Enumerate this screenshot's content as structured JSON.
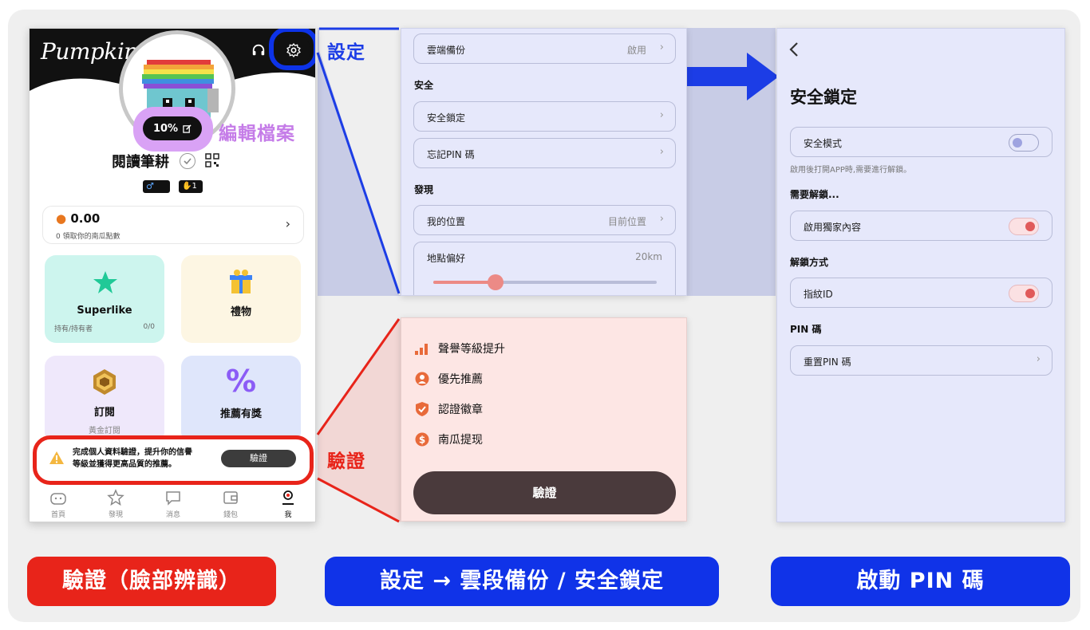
{
  "colors": {
    "blue_accent": "#1c3de6",
    "red_accent": "#e8241a",
    "purple_accent": "#c57ce8",
    "panel_lavender": "#e6e8fb",
    "panel_pink": "#fde6e4",
    "button_dark": "#4a3a3c"
  },
  "profile": {
    "app_logo": "Pumpkin",
    "completion_pct": "10%",
    "edit_annotation": "編輯檔案",
    "username": "閱讀筆耕",
    "gender_badge": "♂",
    "level_badge": "1",
    "points_value": "0.00",
    "points_sub": "0 領取你的南瓜點數",
    "tiles": {
      "superlike": {
        "title": "Superlike",
        "sub_left": "持有/持有者",
        "sub_right": "0/0"
      },
      "gift": {
        "title": "禮物"
      },
      "subscribe": {
        "title": "訂閱",
        "sub": "黃金訂閱"
      },
      "referral": {
        "title": "推薦有獎"
      }
    },
    "verify_banner": {
      "line1": "完成個人資料驗證，提升你的信譽",
      "line2": "等級並獲得更高品質的推薦。",
      "button": "驗證"
    },
    "tabs": [
      {
        "label": "首頁",
        "icon": "home-icon"
      },
      {
        "label": "發現",
        "icon": "star-icon"
      },
      {
        "label": "消息",
        "icon": "chat-icon"
      },
      {
        "label": "錢包",
        "icon": "wallet-icon"
      },
      {
        "label": "我",
        "icon": "profile-icon",
        "active": true
      }
    ]
  },
  "annotations": {
    "settings": "設定",
    "verify": "驗證"
  },
  "settings": {
    "cloud_backup": {
      "label": "雲端備份",
      "value": "啟用"
    },
    "security_section": "安全",
    "security_lock": "安全鎖定",
    "forgot_pin": "忘記PIN 碼",
    "discover_section": "發現",
    "my_location": {
      "label": "我的位置",
      "value": "目前位置"
    },
    "location_pref": {
      "label": "地點偏好",
      "value": "20km",
      "slider_fraction": 0.28
    }
  },
  "verify_panel": {
    "benefits": [
      {
        "label": "聲譽等級提升",
        "icon": "level-up-icon"
      },
      {
        "label": "優先推薦",
        "icon": "person-icon"
      },
      {
        "label": "認證徽章",
        "icon": "badge-icon"
      },
      {
        "label": "南瓜提现",
        "icon": "dollar-icon"
      }
    ],
    "button": "驗證"
  },
  "security_lock": {
    "title": "安全鎖定",
    "safe_mode": {
      "label": "安全模式",
      "on": false
    },
    "safe_mode_hint": "啟用後打開APP時,需要進行解鎖。",
    "need_unlock_section": "需要解鎖...",
    "exclusive_content": {
      "label": "啟用獨家內容",
      "on": true
    },
    "unlock_method_section": "解鎖方式",
    "fingerprint": {
      "label": "指紋ID",
      "on": true
    },
    "pin_section": "PIN 碼",
    "reset_pin": "重置PIN 碼"
  },
  "footer": {
    "verify_face": "驗證（臉部辨識）",
    "settings_path": "設定 → 雲段備份 / 安全鎖定",
    "enable_pin": "啟動 PIN 碼"
  }
}
